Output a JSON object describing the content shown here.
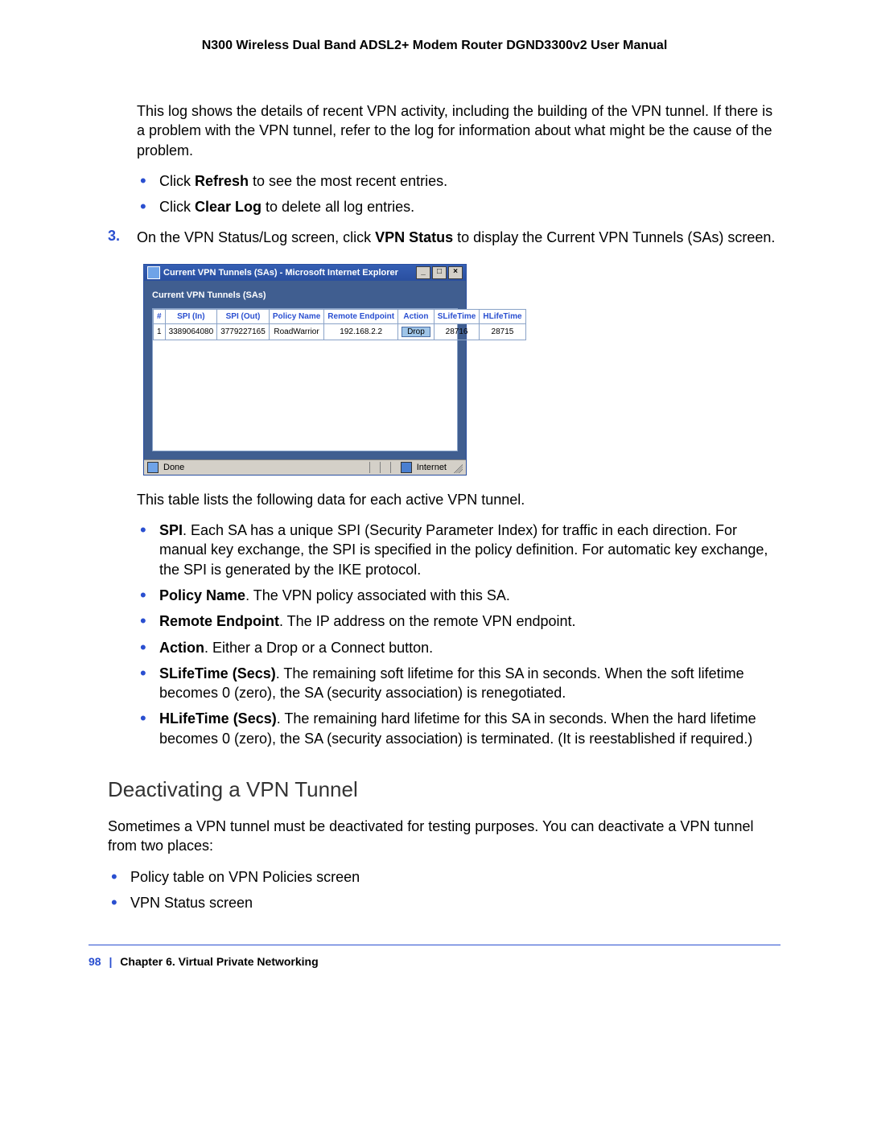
{
  "header": "N300 Wireless Dual Band ADSL2+ Modem Router DGND3300v2 User Manual",
  "intro": "This log shows the details of recent VPN activity, including the building of the VPN tunnel. If there is a problem with the VPN tunnel, refer to the log for information about what might be the cause of the problem.",
  "bullets1_pre1": "Click ",
  "bullets1_b1": "Refresh",
  "bullets1_post1": " to see the most recent entries.",
  "bullets1_pre2": "Click ",
  "bullets1_b2": "Clear Log",
  "bullets1_post2": " to delete all log entries.",
  "step3_num": "3.",
  "step3_pre": "On the VPN Status/Log screen, click ",
  "step3_b": "VPN Status",
  "step3_post": " to display the Current VPN Tunnels (SAs) screen.",
  "ie": {
    "title": "Current VPN Tunnels (SAs) - Microsoft Internet Explorer",
    "heading": "Current VPN Tunnels (SAs)",
    "cols": {
      "c0": "#",
      "c1": "SPI (In)",
      "c2": "SPI (Out)",
      "c3": "Policy Name",
      "c4": "Remote Endpoint",
      "c5": "Action",
      "c6": "SLifeTime",
      "c7": "HLifeTime"
    },
    "row": {
      "c0": "1",
      "c1": "3389064080",
      "c2": "3779227165",
      "c3": "RoadWarrior",
      "c4": "192.168.2.2",
      "c5": "Drop",
      "c6": "28716",
      "c7": "28715"
    },
    "status_done": "Done",
    "status_zone": "Internet"
  },
  "after_table": "This table lists the following data for each active VPN tunnel.",
  "defs": {
    "spi_b": "SPI",
    "spi": ". Each SA has a unique SPI (Security Parameter Index) for traffic in each direction. For manual key exchange, the SPI is specified in the policy definition. For automatic key exchange, the SPI is generated by the IKE protocol.",
    "pol_b": "Policy Name",
    "pol": ". The VPN policy associated with this SA.",
    "rem_b": "Remote Endpoint",
    "rem": ". The IP address on the remote VPN endpoint.",
    "act_b": "Action",
    "act": ". Either a Drop or a Connect button.",
    "sl_b": "SLifeTime (Secs)",
    "sl": ". The remaining soft lifetime for this SA in seconds. When the soft lifetime becomes 0 (zero), the SA (security association) is renegotiated.",
    "hl_b": "HLifeTime (Secs)",
    "hl": ". The remaining hard lifetime for this SA in seconds. When the hard lifetime becomes 0 (zero), the SA (security association) is terminated. (It is reestablished if required.)"
  },
  "section_title": "Deactivating a VPN Tunnel",
  "section_para": "Sometimes a VPN tunnel must be deactivated for testing purposes. You can deactivate a VPN tunnel from two places:",
  "places": {
    "p1": "Policy table on VPN Policies screen",
    "p2": "VPN Status screen"
  },
  "footer": {
    "page": "98",
    "sep": "|",
    "chapter": "Chapter 6.  Virtual Private Networking"
  }
}
